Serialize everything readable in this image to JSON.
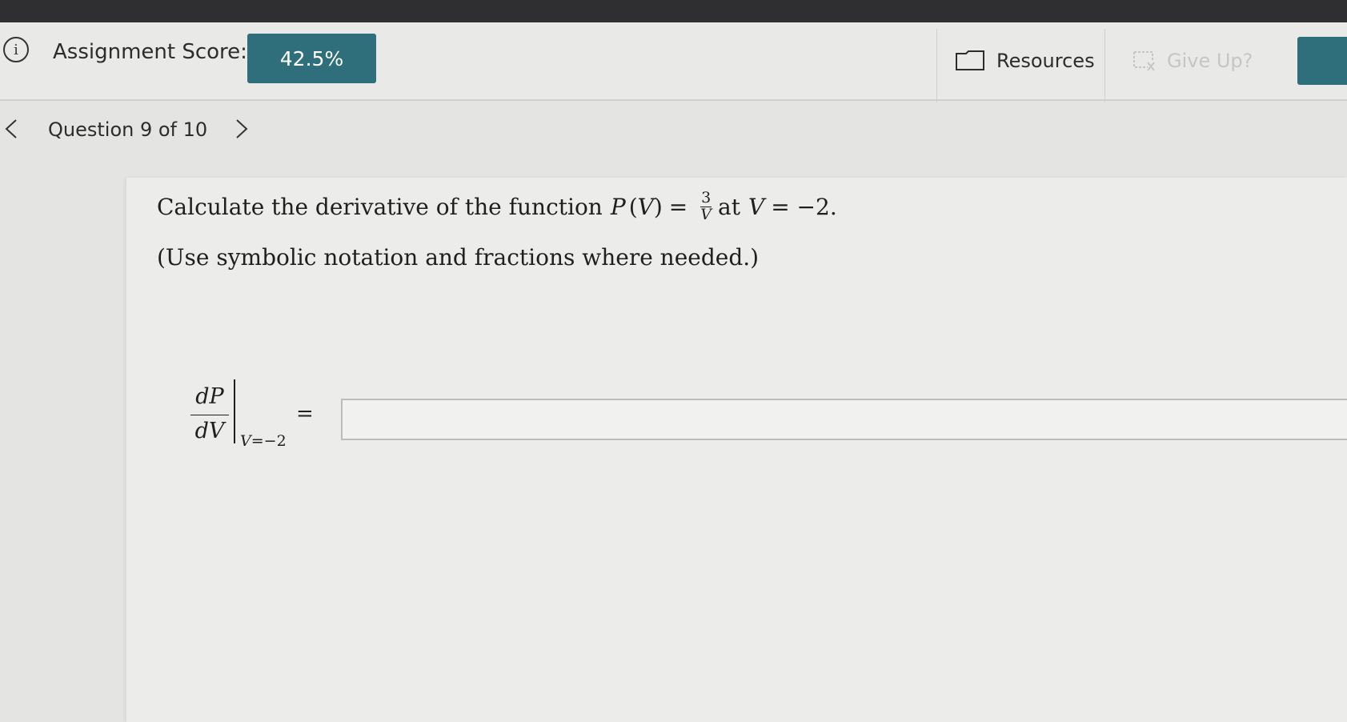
{
  "header": {
    "score_label": "Assignment Score:",
    "score_value": "42.5%",
    "resources_label": "Resources",
    "give_up_label": "Give Up?"
  },
  "nav": {
    "question_counter": "Question 9 of 10"
  },
  "question": {
    "text_prefix": "Calculate the derivative of the function",
    "func_name": "P",
    "func_arg": "V",
    "frac_num": "3",
    "frac_den": "V",
    "text_at": "at",
    "eval_var": "V",
    "eval_value": "= −2.",
    "instructions": "(Use symbolic notation and fractions where needed.)"
  },
  "answer": {
    "deriv_num": "dP",
    "deriv_den": "dV",
    "eval_sub_var": "V",
    "eval_sub_value": "=−2",
    "equals": "=",
    "value": ""
  },
  "colors": {
    "accent": "#2e6f7b",
    "background": "#e4e4e2"
  }
}
